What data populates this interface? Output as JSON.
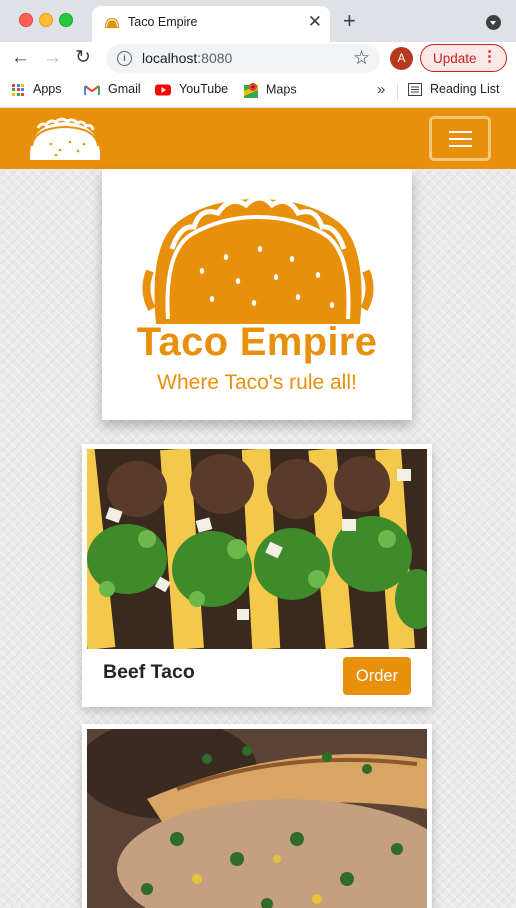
{
  "browser": {
    "tab": {
      "title": "Taco Empire",
      "close_glyph": "✕",
      "favicon": "taco-icon"
    },
    "new_tab_glyph": "+",
    "toolbar": {
      "back_glyph": "←",
      "forward_glyph": "→",
      "reload_glyph": "↻",
      "url_host": "localhost",
      "url_port": ":8080",
      "info_glyph": "i",
      "star_glyph": "☆",
      "avatar_letter": "A",
      "update_label": "Update",
      "update_menu_glyph": "⋮"
    },
    "bookmarks": {
      "items": [
        {
          "label": "Apps",
          "icon": "apps-grid-icon"
        },
        {
          "label": "Gmail",
          "icon": "gmail-icon"
        },
        {
          "label": "YouTube",
          "icon": "youtube-icon"
        },
        {
          "label": "Maps",
          "icon": "maps-icon"
        }
      ],
      "more_glyph": "»",
      "reading_list": "Reading List"
    }
  },
  "site": {
    "brand_color": "#e8900c",
    "hero": {
      "title": "Taco Empire",
      "tagline": "Where Taco's rule all!"
    },
    "menu": [
      {
        "name": "Beef Taco",
        "button": "Order",
        "photo": "beef-taco-photo"
      },
      {
        "name": "",
        "button": "",
        "photo": "quesadilla-photo"
      }
    ]
  }
}
